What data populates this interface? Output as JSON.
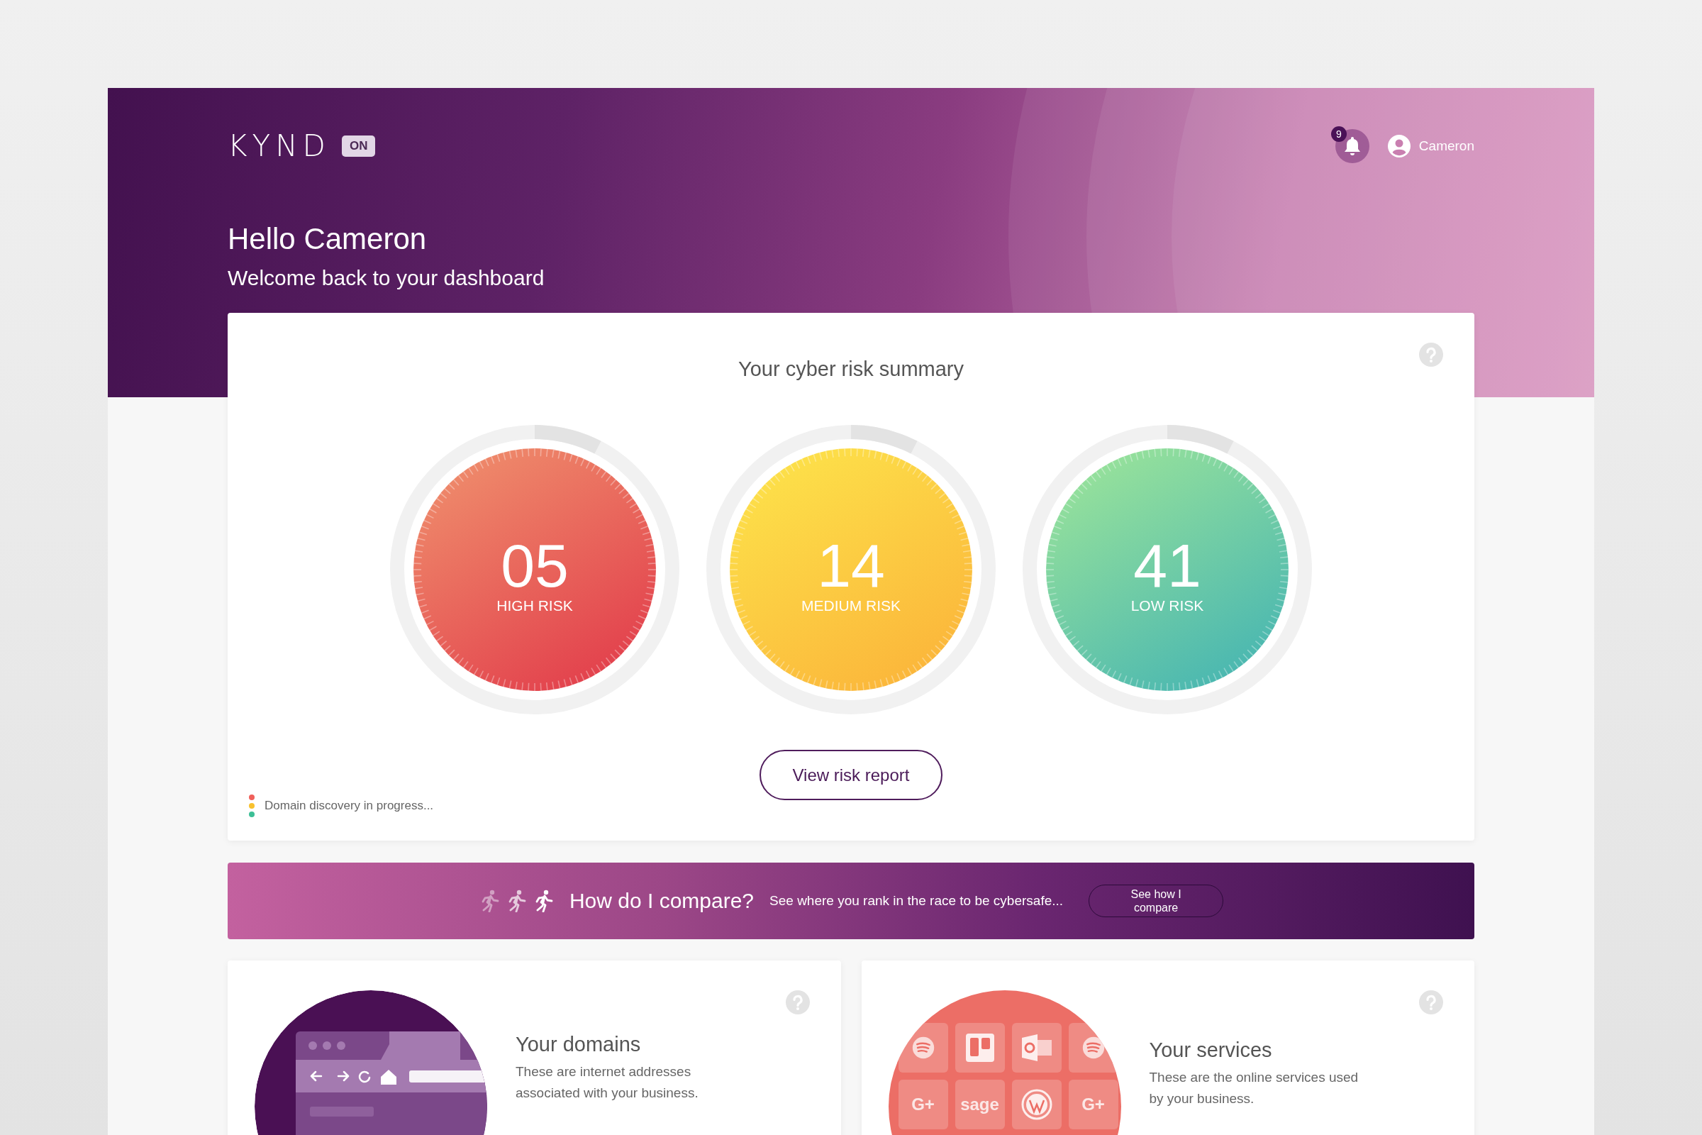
{
  "header": {
    "logo": "KYND",
    "logo_badge": "ON",
    "notifications": {
      "count": "9"
    },
    "user": {
      "name": "Cameron"
    },
    "greeting": "Hello Cameron",
    "subtitle": "Welcome back to your dashboard"
  },
  "risk_summary": {
    "title": "Your cyber risk summary",
    "gauges": [
      {
        "kind": "high",
        "value": "05",
        "label": "HIGH RISK"
      },
      {
        "kind": "medium",
        "value": "14",
        "label": "MEDIUM RISK"
      },
      {
        "kind": "low",
        "value": "41",
        "label": "LOW RISK"
      }
    ],
    "button": "View risk report",
    "status": {
      "dots": [
        {
          "color": "#f0605b"
        },
        {
          "color": "#f8c12e"
        },
        {
          "color": "#3dbf96"
        }
      ],
      "text": "Domain discovery in progress..."
    }
  },
  "compare": {
    "title": "How do I compare?",
    "text": "See where you rank in the race to be cybersafe...",
    "button": "See how I compare"
  },
  "cards": [
    {
      "kind": "domains",
      "title": "Your domains",
      "description": "These are internet addresses associated with your business."
    },
    {
      "kind": "services",
      "title": "Your services",
      "description": "These are the online services used by your business.",
      "tiles": [
        {
          "kind": "stripes"
        },
        {
          "kind": "board"
        },
        {
          "kind": "mail"
        },
        {
          "kind": "stripes"
        },
        {
          "kind": "text",
          "label": "G+"
        },
        {
          "kind": "text",
          "label": "sage"
        },
        {
          "kind": "ring"
        },
        {
          "kind": "text",
          "label": "G+"
        }
      ]
    }
  ]
}
